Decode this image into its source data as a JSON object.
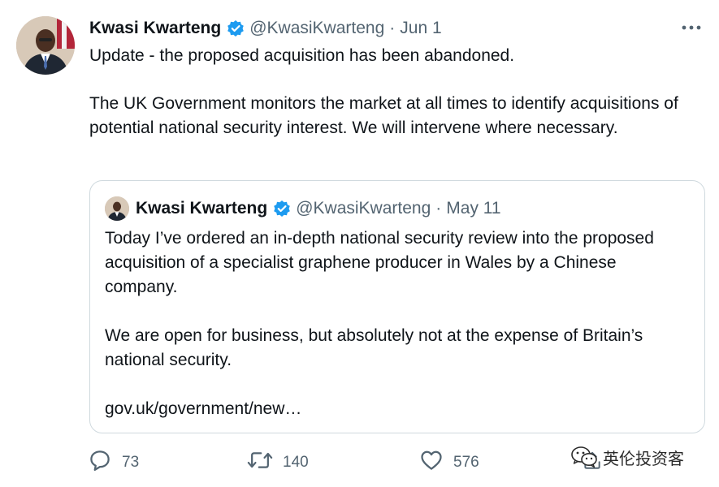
{
  "tweet": {
    "author": {
      "name": "Kwasi Kwarteng",
      "handle": "@KwasiKwarteng",
      "separator": "·",
      "date": "Jun 1"
    },
    "paragraphs": [
      "Update - the proposed acquisition has been abandoned.",
      "The UK Government monitors the market at all times to identify acquisitions of potential national security interest. We will intervene where necessary."
    ],
    "quoted": {
      "author": {
        "name": "Kwasi Kwarteng",
        "handle": "@KwasiKwarteng",
        "separator": "·",
        "date": "May 11"
      },
      "paragraphs": [
        "Today I’ve ordered an in-depth national security review into the proposed acquisition of a specialist graphene producer in Wales by a Chinese company.",
        "We are open for business, but absolutely not at the expense of Britain’s national security.",
        "gov.uk/government/new…"
      ]
    },
    "actions": {
      "replies": "73",
      "retweets": "140",
      "likes": "576"
    }
  },
  "watermark": {
    "text": "英伦投资客"
  },
  "icons": {
    "verified": "verified-badge-icon",
    "more": "more-options-icon",
    "reply": "reply-icon",
    "retweet": "retweet-icon",
    "like": "like-icon",
    "share": "share-icon",
    "wechat": "wechat-icon"
  },
  "colors": {
    "text": "#0f1419",
    "secondary": "#536471",
    "verified": "#1d9bf0",
    "border": "#cfd9de"
  }
}
